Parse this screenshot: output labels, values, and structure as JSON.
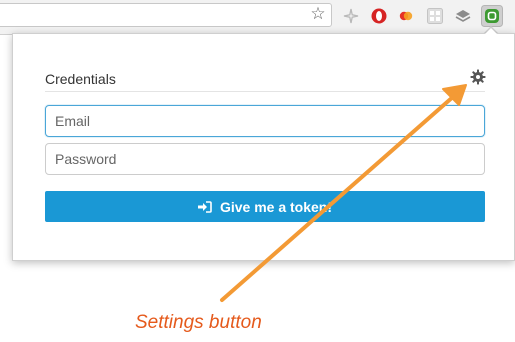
{
  "browser": {
    "bookmark_icon": "star-icon",
    "extension_icons": [
      "sparkle-icon",
      "opera-icon",
      "mastercard-icon",
      "grid-icon",
      "layers-icon",
      "green-extension-icon"
    ]
  },
  "popup": {
    "section_title": "Credentials",
    "settings_icon": "gear-icon",
    "email": {
      "placeholder": "Email",
      "value": ""
    },
    "password": {
      "placeholder": "Password",
      "value": ""
    },
    "submit": {
      "label": "Give me a token!",
      "icon": "sign-in-icon"
    }
  },
  "annotation": {
    "caption": "Settings button"
  },
  "colors": {
    "accent": "#1a98d5",
    "focus_border": "#4aa6d8",
    "annotation_arrow": "#f39a35",
    "annotation_text": "#e55a1c"
  }
}
